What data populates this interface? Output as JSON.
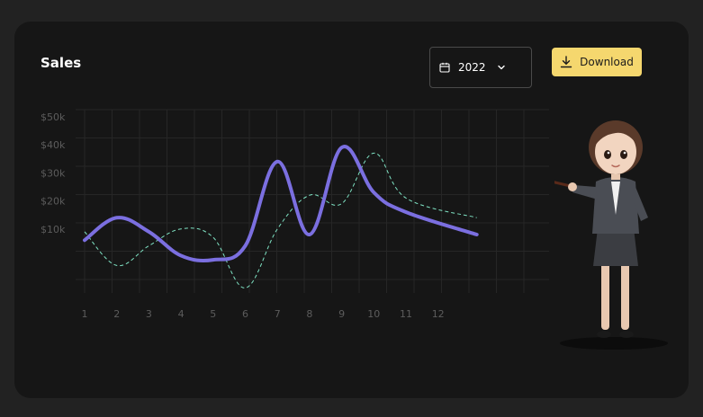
{
  "card": {
    "title": "Sales",
    "year_select": {
      "value": "2022",
      "icon": "calendar-icon",
      "chevron": "chevron-down-icon"
    },
    "download": {
      "label": "Download",
      "icon": "download-icon"
    }
  },
  "colors": {
    "background": "#222222",
    "card": "#161616",
    "primary_line": "#7b6fe0",
    "secondary_line": "#7fe3c4",
    "accent": "#f5d76e",
    "grid": "#262626",
    "axis_text": "#5c5c5c"
  },
  "chart_data": {
    "type": "line",
    "title": "Sales",
    "x": [
      1,
      2,
      3,
      4,
      5,
      6,
      7,
      8,
      9,
      10,
      11,
      12
    ],
    "yticks": [
      "$50k",
      "$40k",
      "$30k",
      "$20k",
      "$10k"
    ],
    "ylim": [
      0,
      60
    ],
    "grid": true,
    "series": [
      {
        "values": [
          6,
          14,
          9,
          0.5,
          -1,
          4,
          34,
          8,
          39,
          23,
          16,
          8
        ]
      },
      {
        "values": [
          9,
          -3,
          4,
          10,
          7,
          -11,
          10,
          22,
          19,
          37,
          21,
          14
        ]
      }
    ]
  }
}
